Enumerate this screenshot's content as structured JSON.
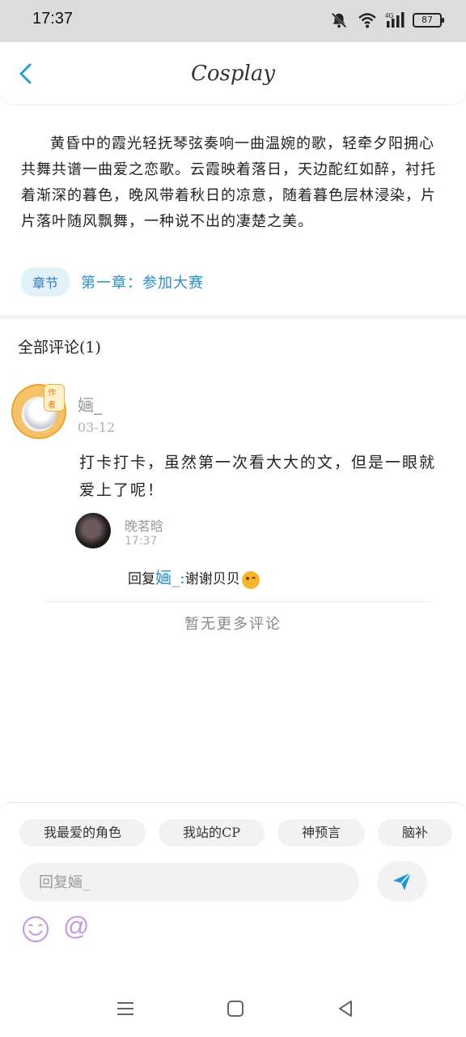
{
  "status_bar": {
    "time": "17:37",
    "battery": "87",
    "signal_label": "4G",
    "icons": [
      "mute-bell-icon",
      "wifi-icon",
      "signal-icon",
      "battery-icon"
    ]
  },
  "header": {
    "title": "Cosplay",
    "back_icon": "chevron-left-icon"
  },
  "article": {
    "text": "黄昏中的霞光轻抚琴弦奏响一曲温婉的歌，轻牵夕阳拥心共舞共谱一曲爱之恋歌。云霞映着落日，天边酡红如醉，衬托着渐深的暮色，晚风带着秋日的凉意，随着暮色层林浸染，片片落叶随风飘舞，一种说不出的凄楚之美。",
    "chapter_tag": "章节",
    "chapter_title": "第一章：参加大赛"
  },
  "comments": {
    "title": "全部评论(1)",
    "items": [
      {
        "user": "婳_",
        "badge": "作者",
        "date": "03-12",
        "text": "打卡打卡，虽然第一次看大大的文，但是一眼就爱上了呢！",
        "reply": {
          "user": "晚茗晗",
          "time": "17:37",
          "prefix": "回复",
          "mention": "婳_",
          "separator": ":",
          "text": "谢谢贝贝"
        }
      }
    ],
    "no_more": "暂无更多评论"
  },
  "composer": {
    "chips": [
      "我最爱的角色",
      "我站的CP",
      "神预言",
      "脑补"
    ],
    "placeholder": "回复婳_",
    "at_symbol": "@"
  },
  "colors": {
    "accent": "#2b8fc8",
    "send": "#1f95d6",
    "emoji_button": "#c89adf"
  }
}
